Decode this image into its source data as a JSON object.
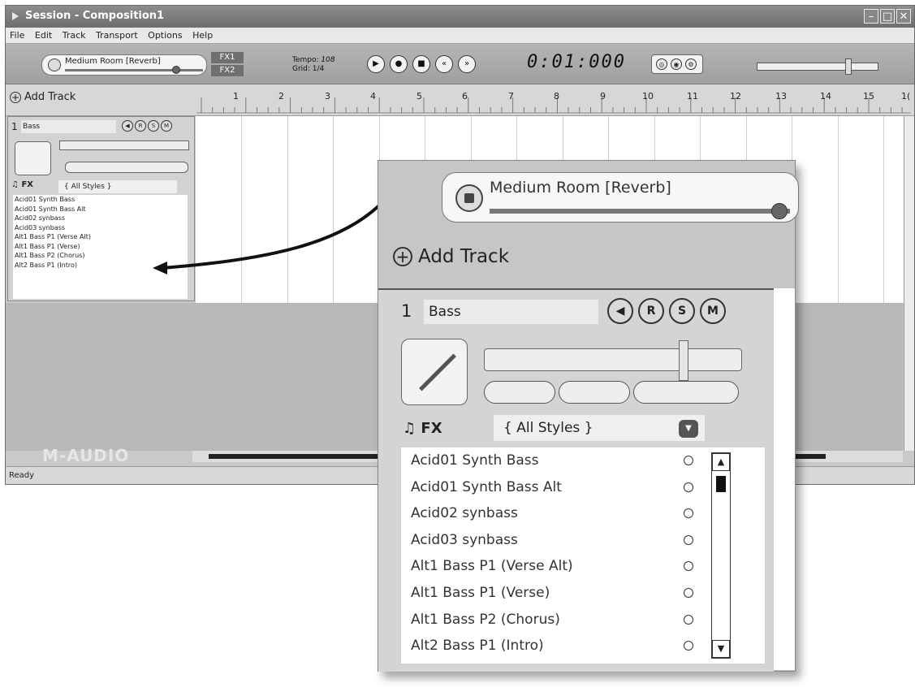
{
  "window": {
    "title": "Session - Composition1"
  },
  "menu": [
    "File",
    "Edit",
    "Track",
    "Transport",
    "Options",
    "Help"
  ],
  "toolbar": {
    "fx_name": "Medium Room [Reverb]",
    "fx1": "FX1",
    "fx2": "FX2",
    "tempo_label": "Tempo:",
    "tempo_value": "108",
    "grid_label": "Grid:",
    "grid_value": "1/4",
    "time": "0:01:000"
  },
  "ruler": {
    "add_track": "Add Track",
    "bars": [
      "1",
      "2",
      "3",
      "4",
      "5",
      "6",
      "7",
      "8",
      "9",
      "10",
      "11",
      "12",
      "13",
      "14",
      "15",
      "1("
    ]
  },
  "track": {
    "number": "1",
    "name": "Bass",
    "buttons": [
      "◀",
      "R",
      "S",
      "M"
    ],
    "fx_label": "FX",
    "style_select": "{ All Styles }",
    "loops": [
      "Acid01 Synth Bass",
      "Acid01 Synth Bass Alt",
      "Acid02 synbass",
      "Acid03 synbass",
      "Alt1 Bass P1 (Verse Alt)",
      "Alt1 Bass P1 (Verse)",
      "Alt1 Bass P2 (Chorus)",
      "Alt2 Bass P1 (Intro)"
    ]
  },
  "brand": "M-AUDIO",
  "status": "Ready",
  "colors": {
    "titlebar": "#7a7a7a",
    "panel": "#c9c9c9",
    "accent": "#555555"
  }
}
